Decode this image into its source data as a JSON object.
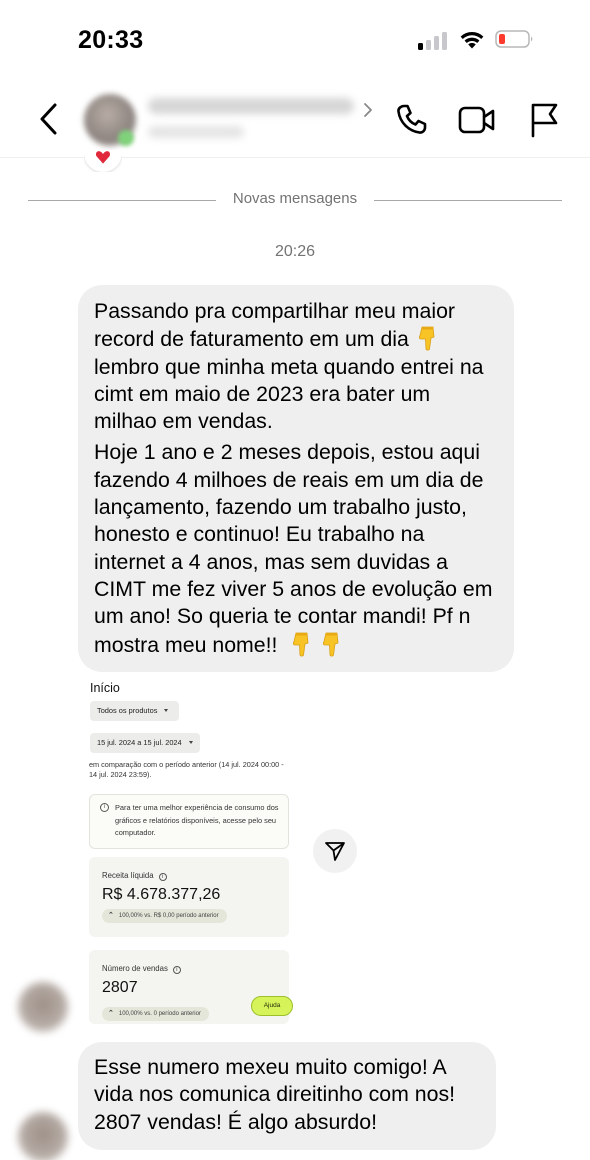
{
  "status_bar": {
    "time": "20:33"
  },
  "chat": {
    "new_messages_label": "Novas mensagens",
    "timestamp": "20:26",
    "messages": [
      {
        "paragraphs": [
          {
            "segments": [
              "Passando pra compartilhar meu maior record de faturamento em um dia",
              "lembro que minha meta quando entrei na cimt em maio de 2023 era bater um milhao em vendas."
            ],
            "emoji_inline": "backhand-index-pointing-down"
          },
          {
            "text": "Hoje 1 ano e 2 meses depois, estou aqui fazendo 4 milhoes de reais em um dia de lançamento, fazendo um trabalho justo, honesto e continuo!  Eu trabalho na internet a 4 anos, mas sem duvidas a CIMT me fez viver 5 anos de evolução em um ano! So queria te contar mandi! Pf n mostra meu nome!!"
          }
        ]
      },
      {
        "text": "Esse numero mexeu muito comigo! A vida nos comunica direitinho com nos! 2807 vendas! É algo absurdo!"
      }
    ]
  },
  "shared_screenshot": {
    "title": "Início",
    "product_filter": "Todos os produtos",
    "date_filter": "15 jul. 2024 a 15 jul. 2024",
    "comparison_text": "em comparação com o período anterior (14 jul. 2024 00:00 - 14 jul. 2024 23:59).",
    "info_text": "Para ter uma melhor experiência de consumo dos gráficos e relatórios disponíveis, acesse pelo seu computador.",
    "revenue": {
      "label": "Receita líquida",
      "value": "R$ 4.678.377,26",
      "badge": "100,00% vs. R$ 0,00 período anterior"
    },
    "sales": {
      "label": "Número de vendas",
      "value": "2807",
      "badge": "100,00% vs. 0 período anterior"
    },
    "help_label": "Ajuda"
  },
  "icons": {
    "back": "chevron-left-icon",
    "call": "phone-icon",
    "video": "video-camera-icon",
    "report": "flag-icon",
    "share": "send-icon",
    "emoji": "backhand-index-pointing-down"
  }
}
